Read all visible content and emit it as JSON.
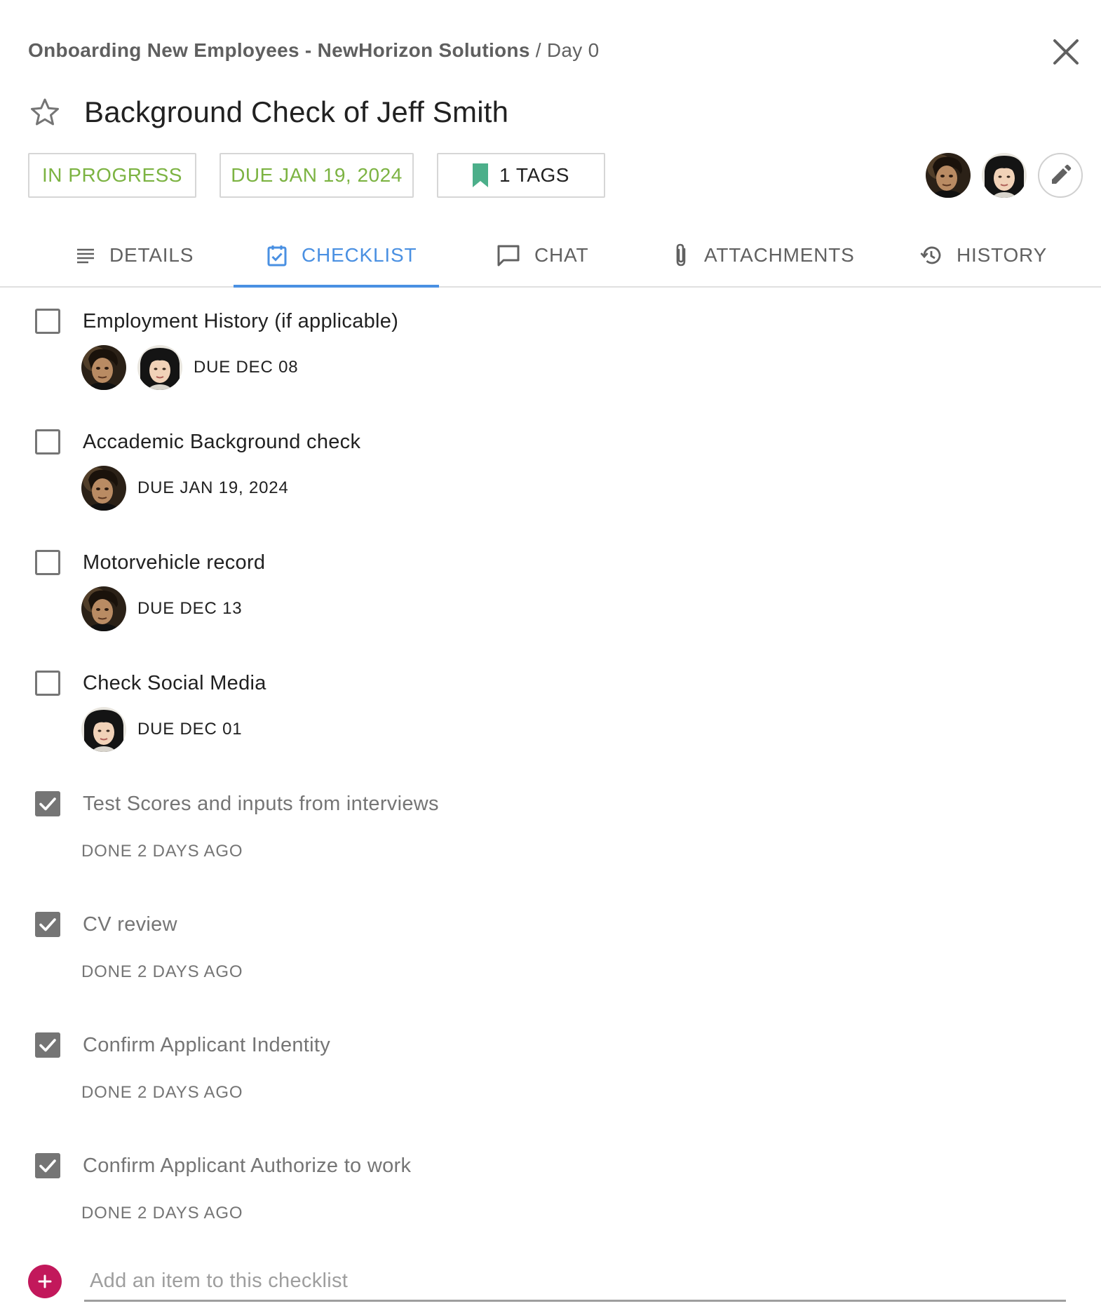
{
  "header": {
    "project": "Onboarding New Employees - NewHorizon Solutions",
    "separator": "/",
    "stage": "Day 0",
    "close_icon": "close-icon",
    "star_icon": "star-outline-icon",
    "title": "Background Check of Jeff Smith"
  },
  "chips": {
    "status": "IN PROGRESS",
    "due": "DUE JAN 19, 2024",
    "tags": "1 TAGS",
    "tags_icon": "bookmark-icon"
  },
  "assignees": [
    {
      "avatar": "man-avatar"
    },
    {
      "avatar": "woman-avatar"
    }
  ],
  "edit_icon": "pencil-icon",
  "tabs": [
    {
      "label": "DETAILS",
      "icon": "notes-icon",
      "active": false
    },
    {
      "label": "CHECKLIST",
      "icon": "checklist-icon",
      "active": true
    },
    {
      "label": "CHAT",
      "icon": "chat-icon",
      "active": false
    },
    {
      "label": "ATTACHMENTS",
      "icon": "paperclip-icon",
      "active": false
    },
    {
      "label": "HISTORY",
      "icon": "history-icon",
      "active": false
    }
  ],
  "checklist": {
    "items": [
      {
        "label": "Employment History (if applicable)",
        "checked": false,
        "meta": "DUE DEC 08",
        "avatars": [
          "man-avatar",
          "woman-avatar"
        ]
      },
      {
        "label": "Accademic Background check",
        "checked": false,
        "meta": "DUE JAN 19, 2024",
        "avatars": [
          "man-avatar"
        ]
      },
      {
        "label": "Motorvehicle record",
        "checked": false,
        "meta": "DUE DEC 13",
        "avatars": [
          "man-avatar"
        ]
      },
      {
        "label": "Check Social Media",
        "checked": false,
        "meta": "DUE DEC 01",
        "avatars": [
          "woman-avatar"
        ]
      },
      {
        "label": "Test Scores and inputs from interviews",
        "checked": true,
        "meta": "DONE 2 DAYS AGO",
        "avatars": []
      },
      {
        "label": "CV review",
        "checked": true,
        "meta": "DONE 2 DAYS AGO",
        "avatars": []
      },
      {
        "label": "Confirm Applicant Indentity",
        "checked": true,
        "meta": "DONE 2 DAYS AGO",
        "avatars": []
      },
      {
        "label": "Confirm Applicant Authorize to work",
        "checked": true,
        "meta": "DONE 2 DAYS AGO",
        "avatars": []
      }
    ],
    "add_placeholder": "Add an item to this checklist",
    "add_icon": "plus-icon"
  },
  "colors": {
    "accent": "#4a90e2",
    "status_green": "#7cb342",
    "add_button": "#c2185b",
    "bookmark": "#4caf8a",
    "checkbox": "#757575"
  }
}
